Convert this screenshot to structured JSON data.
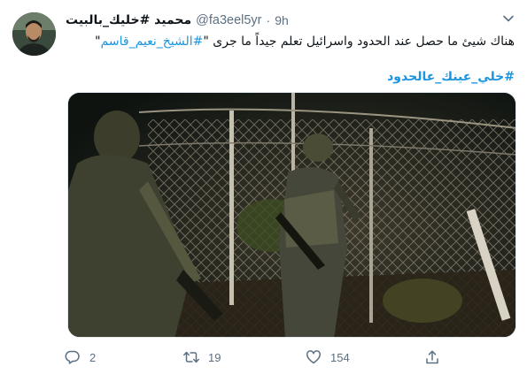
{
  "tweet": {
    "display_name": "محميد #خليك_بالبيت",
    "handle": "@fa3eel5yr",
    "separator": "·",
    "time": "9h",
    "text_part1": "هناك شيئ ما حصل عند الحدود واسرائيل تعلم جيداً ما جرى \"",
    "hashtag_inline": "#الشيخ_نعيم_قاسم",
    "text_part2": "\"",
    "hashtag_line": "#خلي_عينك_عالحدود"
  },
  "actions": {
    "reply_count": "2",
    "retweet_count": "19",
    "like_count": "154"
  },
  "colors": {
    "link": "#1b95e0",
    "secondary_text": "#5b7083",
    "primary_text": "#0f1419"
  },
  "icons": [
    "chevron-down-icon",
    "reply-icon",
    "retweet-icon",
    "like-icon",
    "share-icon"
  ]
}
